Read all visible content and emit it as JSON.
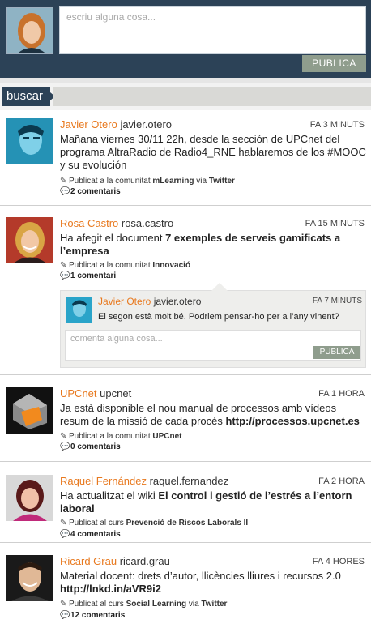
{
  "composer": {
    "placeholder": "escriu alguna cosa...",
    "publish_label": "PUBLICA"
  },
  "search": {
    "label": "buscar"
  },
  "posts": [
    {
      "name": "Javier Otero",
      "username": "javier.otero",
      "time": "FA 3 MINUTS",
      "text": "Mañana viernes 30/11 22h, desde la sección de UPCnet del programa AltraRadio de Radio4_RNE hablaremos de los #MOOC y su evolución",
      "meta_prefix": "Publicat a la comunitat ",
      "meta_place": "mLearning",
      "meta_via": " via ",
      "meta_source": "Twitter",
      "comments": "2 comentaris"
    },
    {
      "name": "Rosa Castro",
      "username": "rosa.castro",
      "time": "FA 15 MINUTS",
      "text_prefix": "Ha afegit el document ",
      "text_bold": "7 exemples de serveis gamificats a l’empresa",
      "meta_prefix": "Publicat a la comunitat ",
      "meta_place": "Innovació",
      "comments": "1 comentari",
      "comment": {
        "name": "Javier Otero",
        "username": "javier.otero",
        "time": "FA 7 MINUTS",
        "text": "El segon està molt bé. Podriem pensar-ho per a l’any vinent?",
        "placeholder": "comenta alguna cosa...",
        "publish_label": "PUBLICA"
      }
    },
    {
      "name": "UPCnet",
      "username": "upcnet",
      "time": "FA 1 HORA",
      "text": "Ja està disponible el nou manual de processos amb vídeos resum de la missió de cada procés ",
      "text_link": "http://processos.upcnet.es",
      "meta_prefix": "Publicat a la comunitat ",
      "meta_place": "UPCnet",
      "comments": "0 comentaris"
    },
    {
      "name": "Raquel Fernández",
      "username": "raquel.fernandez",
      "time": "FA 2 HORA",
      "text_prefix": "Ha actualitzat el wiki ",
      "text_bold": "El control i gestió de l’estrés a l’entorn laboral",
      "meta_prefix": "Publicat al curs ",
      "meta_place": "Prevenció de Riscos Laborals II",
      "comments": "4 comentaris"
    },
    {
      "name": "Ricard Grau",
      "username": "ricard.grau",
      "time": "FA 4 HORES",
      "text": "Material docent: drets d’autor, llicències lliures i recursos 2.0 ",
      "text_link": "http://lnkd.in/aVR9i2",
      "meta_prefix": "Publicat al curs ",
      "meta_place": "Social Learning",
      "meta_via": " via ",
      "meta_source": "Twitter",
      "comments": "12 comentaris"
    }
  ],
  "colors": {
    "header_bg": "#2c4257",
    "name_orange": "#e8791f",
    "publish_btn": "#8f9d8d"
  }
}
